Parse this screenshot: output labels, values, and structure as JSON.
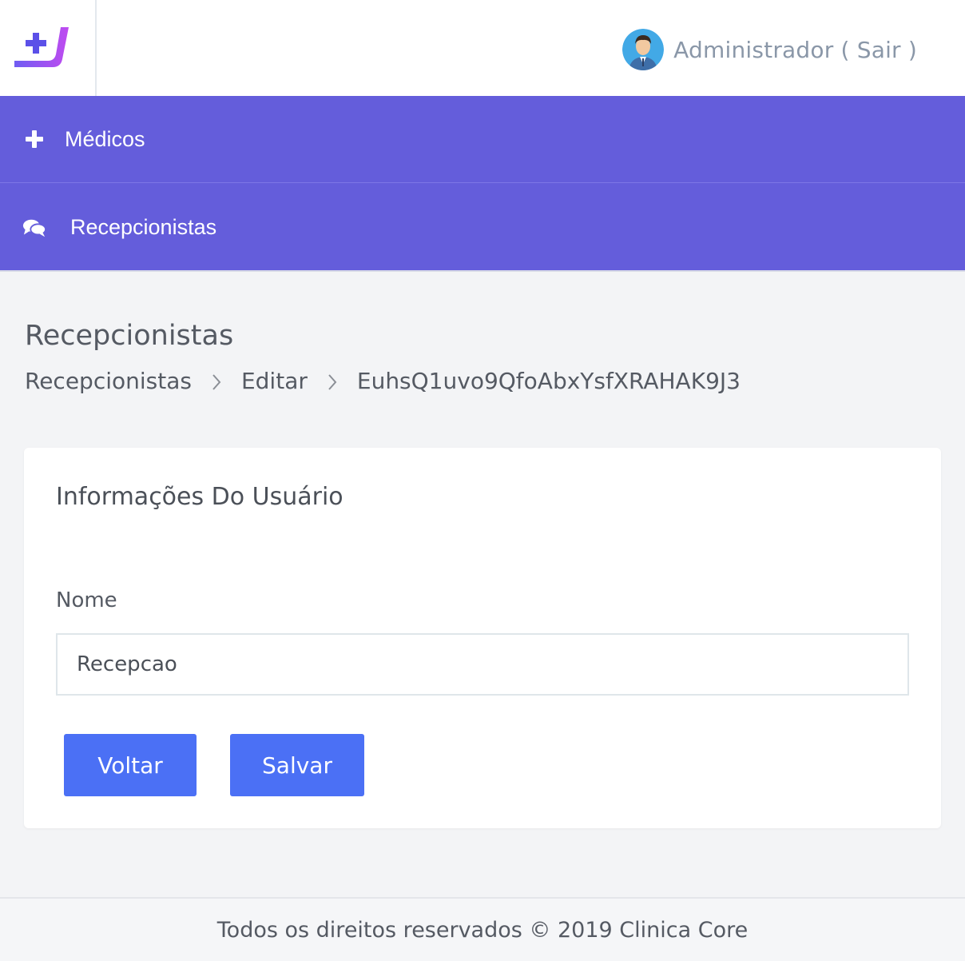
{
  "header": {
    "logo": "clinic-logo",
    "user_label": "Administrador ( Sair )"
  },
  "menu": {
    "items": [
      {
        "icon": "plus-icon",
        "label": "Médicos"
      },
      {
        "icon": "comments-icon",
        "label": "Recepcionistas"
      }
    ]
  },
  "page": {
    "title": "Recepcionistas",
    "breadcrumb": [
      "Recepcionistas",
      "Editar",
      "EuhsQ1uvo9QfoAbxYsfXRAHAK9J3"
    ]
  },
  "card": {
    "title": "Informações Do Usuário",
    "name_label": "Nome",
    "name_value": "Recepcao",
    "back_label": "Voltar",
    "save_label": "Salvar"
  },
  "footer": {
    "text": "Todos os direitos reservados © 2019 Clinica Core"
  },
  "colors": {
    "menu_bg": "#645ddb",
    "button_bg": "#4b70f5",
    "logo_gradient_start": "#6f5cf2",
    "logo_gradient_end": "#c04bf0"
  }
}
